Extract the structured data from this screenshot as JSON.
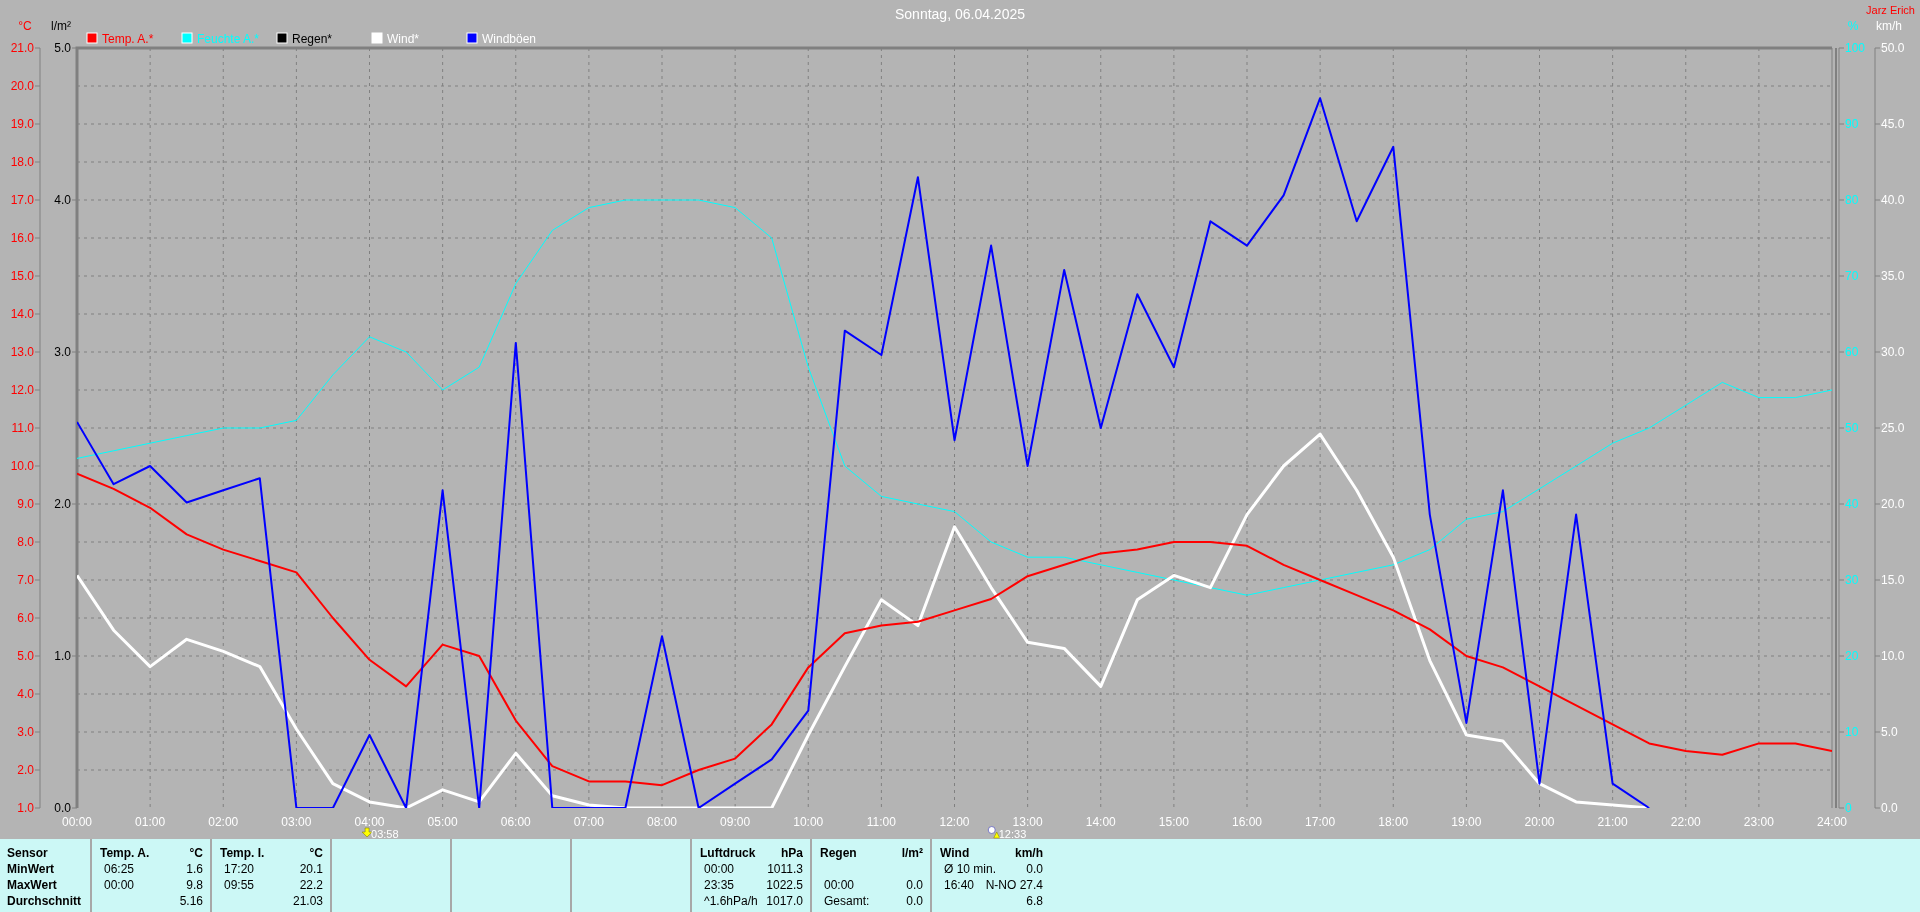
{
  "author": "Jarz Erich",
  "chart_data": {
    "type": "line",
    "title": "Sonntag, 06.04.2025",
    "x": [
      0,
      0.5,
      1,
      1.5,
      2,
      2.5,
      3,
      3.5,
      4,
      4.5,
      5,
      5.5,
      6,
      6.5,
      7,
      7.5,
      8,
      8.5,
      9,
      9.5,
      10,
      10.5,
      11,
      11.5,
      12,
      12.5,
      13,
      13.5,
      14,
      14.5,
      15,
      15.5,
      16,
      16.5,
      17,
      17.5,
      18,
      18.5,
      19,
      19.5,
      20,
      20.5,
      21,
      21.5,
      22,
      22.5,
      23,
      23.5,
      24
    ],
    "xlim": [
      0,
      24
    ],
    "xticks": [
      {
        "value": 0,
        "label": "00:00"
      },
      {
        "value": 1,
        "label": "01:00"
      },
      {
        "value": 2,
        "label": "02:00"
      },
      {
        "value": 3,
        "label": "03:00"
      },
      {
        "value": 4,
        "label": "04:00"
      },
      {
        "value": 5,
        "label": "05:00"
      },
      {
        "value": 6,
        "label": "06:00"
      },
      {
        "value": 7,
        "label": "07:00"
      },
      {
        "value": 8,
        "label": "08:00"
      },
      {
        "value": 9,
        "label": "09:00"
      },
      {
        "value": 10,
        "label": "10:00"
      },
      {
        "value": 11,
        "label": "11:00"
      },
      {
        "value": 12,
        "label": "12:00"
      },
      {
        "value": 13,
        "label": "13:00"
      },
      {
        "value": 14,
        "label": "14:00"
      },
      {
        "value": 15,
        "label": "15:00"
      },
      {
        "value": 16,
        "label": "16:00"
      },
      {
        "value": 17,
        "label": "17:00"
      },
      {
        "value": 18,
        "label": "18:00"
      },
      {
        "value": 19,
        "label": "19:00"
      },
      {
        "value": 20,
        "label": "20:00"
      },
      {
        "value": 21,
        "label": "21:00"
      },
      {
        "value": 22,
        "label": "22:00"
      },
      {
        "value": 23,
        "label": "23:00"
      },
      {
        "value": 24,
        "label": "24:00"
      }
    ],
    "ylabel": "°C",
    "ylim": [
      1,
      21
    ],
    "yticks": [
      {
        "value": 1,
        "label": "1.0"
      },
      {
        "value": 2,
        "label": "2.0"
      },
      {
        "value": 3,
        "label": "3.0"
      },
      {
        "value": 4,
        "label": "4.0"
      },
      {
        "value": 5,
        "label": "5.0"
      },
      {
        "value": 6,
        "label": "6.0"
      },
      {
        "value": 7,
        "label": "7.0"
      },
      {
        "value": 8,
        "label": "8.0"
      },
      {
        "value": 9,
        "label": "9.0"
      },
      {
        "value": 10,
        "label": "10.0"
      },
      {
        "value": 11,
        "label": "11.0"
      },
      {
        "value": 12,
        "label": "12.0"
      },
      {
        "value": 13,
        "label": "13.0"
      },
      {
        "value": 14,
        "label": "14.0"
      },
      {
        "value": 15,
        "label": "15.0"
      },
      {
        "value": 16,
        "label": "16.0"
      },
      {
        "value": 17,
        "label": "17.0"
      },
      {
        "value": 18,
        "label": "18.0"
      },
      {
        "value": 19,
        "label": "19.0"
      },
      {
        "value": 20,
        "label": "20.0"
      },
      {
        "value": 21,
        "label": "21.0"
      }
    ],
    "y2label": "%",
    "y2lim": [
      0,
      100
    ],
    "y2ticks": [
      {
        "value": 0,
        "label": "0"
      },
      {
        "value": 10,
        "label": "10"
      },
      {
        "value": 20,
        "label": "20"
      },
      {
        "value": 30,
        "label": "30"
      },
      {
        "value": 40,
        "label": "40"
      },
      {
        "value": 50,
        "label": "50"
      },
      {
        "value": 60,
        "label": "60"
      },
      {
        "value": 70,
        "label": "70"
      },
      {
        "value": 80,
        "label": "80"
      },
      {
        "value": 90,
        "label": "90"
      },
      {
        "value": 100,
        "label": "100"
      }
    ],
    "y3label": "km/h",
    "y3lim": [
      0,
      50
    ],
    "y3ticks": [
      {
        "value": 0,
        "label": "0.0"
      },
      {
        "value": 5,
        "label": "5.0"
      },
      {
        "value": 10,
        "label": "10.0"
      },
      {
        "value": 15,
        "label": "15.0"
      },
      {
        "value": 20,
        "label": "20.0"
      },
      {
        "value": 25,
        "label": "25.0"
      },
      {
        "value": 30,
        "label": "30.0"
      },
      {
        "value": 35,
        "label": "35.0"
      },
      {
        "value": 40,
        "label": "40.0"
      },
      {
        "value": 45,
        "label": "45.0"
      },
      {
        "value": 50,
        "label": "50.0"
      }
    ],
    "series": [
      {
        "name": "Temp. A.*",
        "color": "#ff0000",
        "values": [
          9.8,
          9.4,
          8.9,
          8.2,
          7.8,
          7.5,
          7.2,
          6.0,
          4.9,
          4.2,
          5.3,
          5.0,
          3.3,
          2.1,
          1.7,
          1.7,
          1.6,
          2.0,
          2.3,
          3.2,
          4.7,
          5.6,
          5.8,
          5.9,
          6.2,
          6.5,
          7.1,
          7.4,
          7.7,
          7.8,
          8.0,
          8.0,
          7.9,
          7.4,
          7.0,
          6.6,
          6.2,
          5.7,
          5.0,
          4.7,
          4.2,
          3.7,
          3.2,
          2.7,
          2.5,
          2.4,
          2.7,
          2.7,
          2.5
        ]
      },
      {
        "name": "Feuchte A.*",
        "color": "#00ffff",
        "axis": "y2",
        "values": [
          46,
          47,
          48,
          49,
          50,
          50,
          51,
          57,
          62,
          60,
          55,
          58,
          69,
          76,
          79,
          80,
          80,
          80,
          79,
          75,
          58,
          45,
          41,
          40,
          39,
          35,
          33,
          33,
          32,
          31,
          30,
          29,
          28,
          29,
          30,
          31,
          32,
          34,
          38,
          39,
          42,
          45,
          48,
          50,
          53,
          56,
          54,
          54,
          55
        ]
      },
      {
        "name": "Regen*",
        "color": "#000000",
        "values": [
          null,
          null,
          null,
          null,
          null,
          null,
          null,
          null,
          null,
          null,
          null,
          null,
          null,
          null,
          null,
          null,
          null,
          null,
          null,
          null,
          null,
          null,
          null,
          null,
          null,
          null,
          null,
          null,
          null,
          null,
          null,
          null,
          null,
          null,
          null,
          null,
          null,
          null,
          null,
          null,
          null,
          null,
          null,
          null,
          null,
          null,
          null,
          null,
          null
        ]
      },
      {
        "name": "Wind*",
        "color": "#ffffff",
        "axis": "y3",
        "values": [
          15.3,
          11.7,
          9.3,
          11.1,
          10.3,
          9.3,
          5.2,
          1.6,
          0.4,
          0.0,
          1.2,
          0.4,
          3.6,
          0.8,
          0.2,
          0.0,
          0.0,
          0.0,
          0.0,
          0.0,
          4.8,
          9.3,
          13.7,
          12.0,
          18.5,
          14.5,
          10.9,
          10.5,
          8.0,
          13.7,
          15.3,
          14.5,
          19.3,
          22.5,
          24.6,
          20.9,
          16.5,
          9.7,
          4.8,
          4.4,
          1.6,
          0.4,
          0.2,
          0.0,
          null,
          null,
          null,
          null,
          null
        ]
      },
      {
        "name": "Windböen",
        "color": "#0000ff",
        "axis": "y3",
        "values": [
          25.4,
          21.3,
          22.5,
          20.1,
          20.9,
          21.7,
          0.0,
          0.0,
          4.8,
          0.0,
          20.9,
          0.0,
          30.6,
          0.0,
          0.0,
          0.0,
          11.3,
          0.0,
          1.6,
          3.2,
          6.4,
          31.4,
          29.8,
          41.5,
          24.2,
          37.0,
          22.5,
          35.4,
          25.0,
          33.8,
          29.0,
          38.6,
          37.0,
          40.3,
          46.7,
          38.6,
          43.5,
          19.3,
          5.6,
          20.9,
          1.6,
          19.3,
          1.6,
          0.0,
          null,
          null,
          null,
          null,
          null
        ]
      }
    ],
    "grid": true,
    "legend": "top"
  },
  "markers": [
    {
      "kind": "sunrise",
      "text": "03:58"
    },
    {
      "kind": "noon",
      "text": "12:33"
    }
  ],
  "legend_text": [
    {
      "color": "#ff0000"
    },
    {
      "color": "#00ffff"
    },
    {
      "color": "#000000"
    },
    {
      "color": "#ffffff"
    },
    {
      "color": "#ffffff"
    }
  ],
  "rain_axis": {
    "ylabel": "l/m²",
    "color": "#000000",
    "ticks": [
      "5.0",
      "4.0",
      "3.0",
      "2.0",
      "1.0",
      "0.0"
    ]
  },
  "summary": {
    "row_labels": [
      "Sensor",
      "MinWert",
      "MaxWert",
      "Durchschnitt"
    ],
    "columns": [
      {
        "kind": "data",
        "title": "Temp. A.",
        "unit": "°C",
        "rows": [
          {
            "label": "06:25",
            "value": "1.6"
          },
          {
            "label": "00:00",
            "value": "9.8"
          },
          {
            "value": "5.16"
          }
        ]
      },
      {
        "kind": "data",
        "title": "Temp. I.",
        "unit": "°C",
        "rows": [
          {
            "label": "17:20",
            "value": "20.1"
          },
          {
            "label": "09:55",
            "value": "22.2"
          },
          {
            "value": "21.03"
          }
        ]
      },
      {
        "kind": "blank"
      },
      {
        "kind": "blank"
      },
      {
        "kind": "blank"
      },
      {
        "kind": "data",
        "title": "Luftdruck",
        "unit": "hPa",
        "rows": [
          {
            "label": "00:00",
            "value": "1011.3"
          },
          {
            "label": "23:35",
            "value": "1022.5"
          },
          {
            "label": "^1.6hPa/h",
            "value": "1017.0"
          }
        ]
      },
      {
        "kind": "data",
        "title": "Regen",
        "unit": "l/m²",
        "rows": [
          {},
          {
            "label": "00:00",
            "value": "0.0"
          },
          {
            "label": "Gesamt:",
            "value": "0.0"
          }
        ]
      },
      {
        "kind": "data",
        "title": "Wind",
        "unit": "km/h",
        "rows": [
          {
            "label": "Ø 10 min.",
            "value": "0.0"
          },
          {
            "label": "16:40",
            "value": "N-NO 27.4"
          },
          {
            "value": "6.8"
          }
        ]
      }
    ]
  }
}
